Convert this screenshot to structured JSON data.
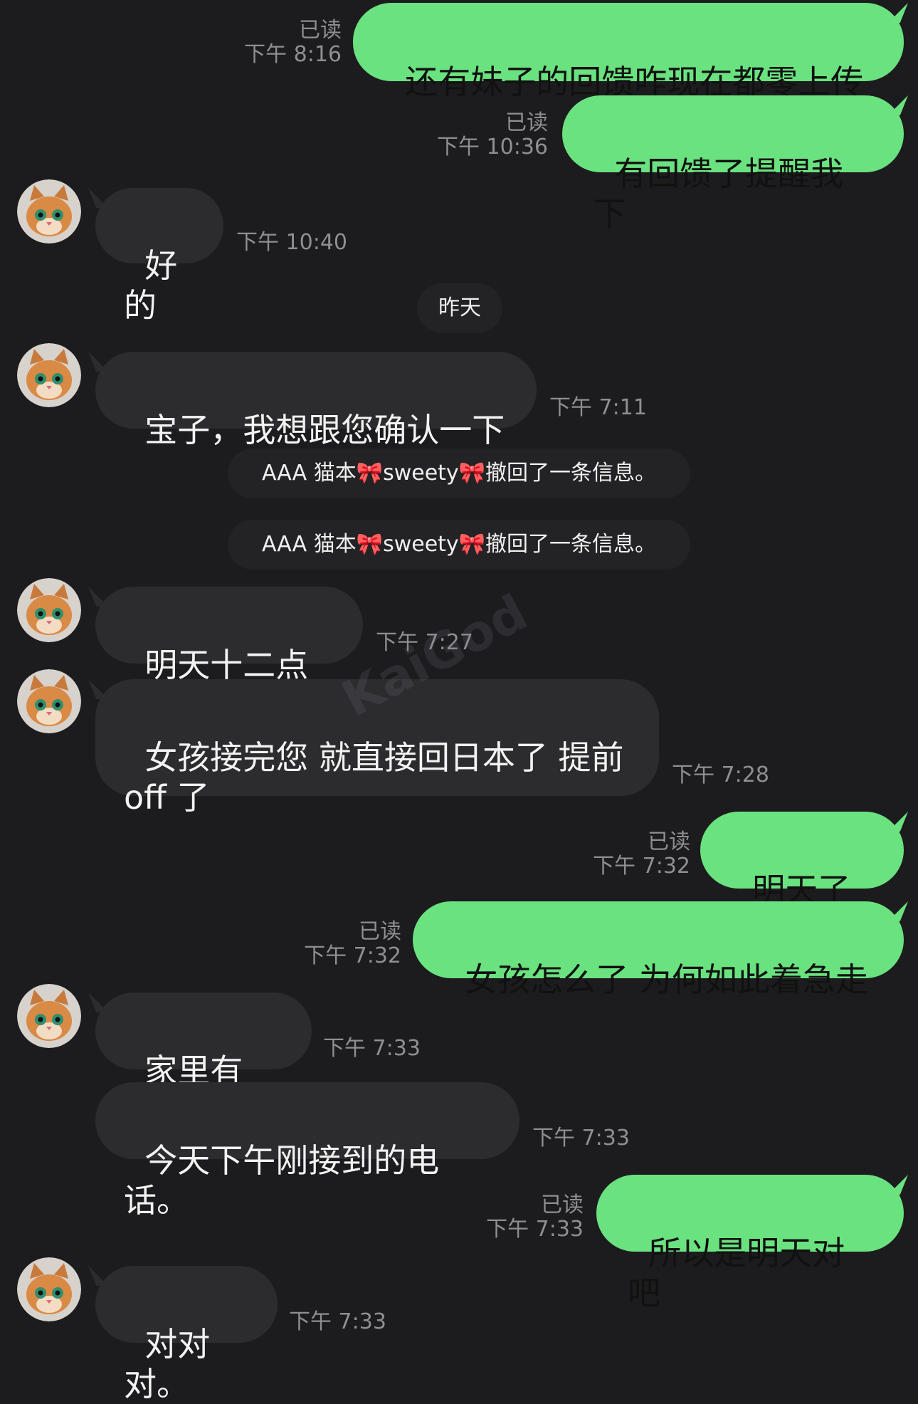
{
  "messages": [
    {
      "id": "m1",
      "side": "out",
      "text": "还有妹子的回馈咋现在都零上传",
      "read": "已读",
      "time": "下午 8:16"
    },
    {
      "id": "m2",
      "side": "out",
      "text": "有回馈了提醒我下",
      "read": "已读",
      "time": "下午 10:36"
    },
    {
      "id": "m3",
      "side": "in",
      "text": "好的",
      "time": "下午 10:40"
    },
    {
      "id": "date1",
      "type": "date",
      "text": "昨天"
    },
    {
      "id": "m4",
      "side": "in",
      "text": "宝子，我想跟您确认一下",
      "time": "下午 7:11"
    },
    {
      "id": "sys1",
      "type": "system",
      "prefix": "AAA 猫本",
      "bow": "🎀",
      "name": "sweety",
      "suffix": "撤回了一条信息。"
    },
    {
      "id": "sys2",
      "type": "system",
      "prefix": "AAA 猫本",
      "bow": "🎀",
      "name": "sweety",
      "suffix": "撤回了一条信息。"
    },
    {
      "id": "m5",
      "side": "in",
      "text": "明天十二点见",
      "time": "下午 7:27"
    },
    {
      "id": "m6",
      "side": "in",
      "text": "女孩接完您 就直接回日本了 提前\noff 了",
      "time": "下午 7:28"
    },
    {
      "id": "m7",
      "side": "out",
      "text": "明天了吗",
      "read": "已读",
      "time": "下午 7:32"
    },
    {
      "id": "m8",
      "side": "out",
      "text": "女孩怎么了 为何如此着急走",
      "read": "已读",
      "time": "下午 7:32"
    },
    {
      "id": "m9",
      "side": "in",
      "text": "家里有事。",
      "time": "下午 7:33"
    },
    {
      "id": "m10",
      "side": "in",
      "text": "今天下午刚接到的电话。",
      "time": "下午 7:33"
    },
    {
      "id": "m11",
      "side": "out",
      "text": "所以是明天对吧",
      "read": "已读",
      "time": "下午 7:33"
    },
    {
      "id": "m12",
      "side": "in",
      "text": "对对对。",
      "time": "下午 7:33"
    }
  ],
  "watermark": "KaiGod",
  "colors": {
    "background": "#1c1c1e",
    "incoming": "#2c2c2e",
    "outgoing": "#6ae27f",
    "meta": "#8e8e93"
  },
  "avatar_icon": "cat-avatar-icon"
}
